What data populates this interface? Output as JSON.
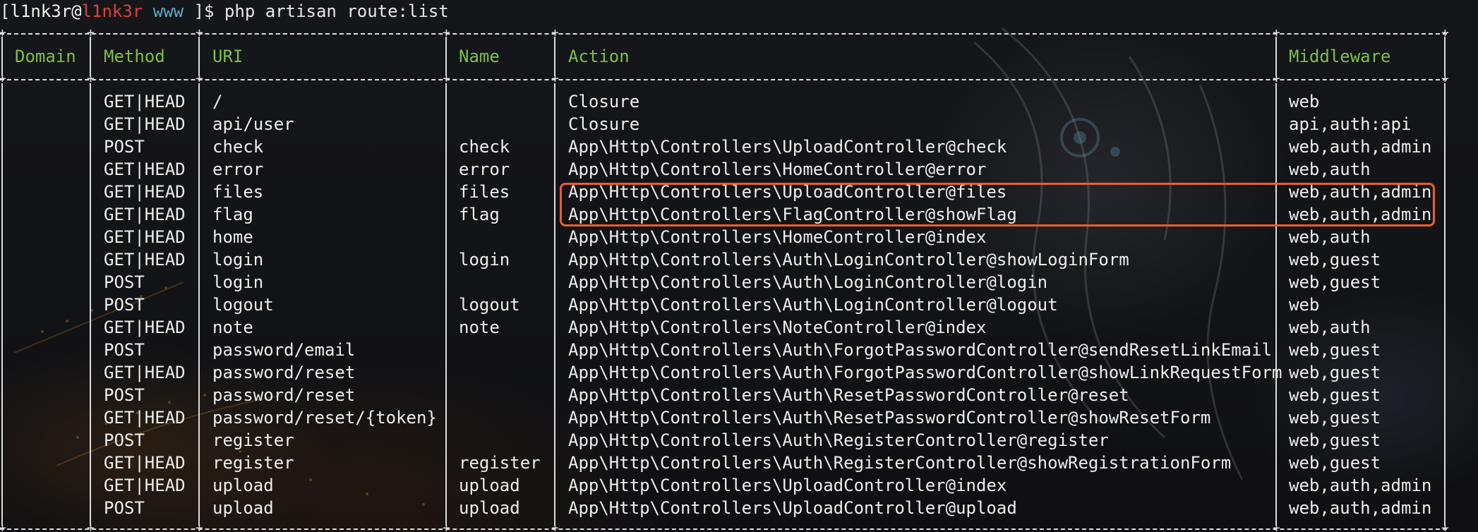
{
  "prompt": {
    "open_bracket": "[",
    "user": "l1nk3r",
    "at": "@",
    "host": "l1nk3r",
    "dir": "www",
    "suffix": " ]$ ",
    "command": "php artisan route:list"
  },
  "table": {
    "headers": {
      "domain": "Domain",
      "method": "Method",
      "uri": "URI",
      "name": "Name",
      "action": "Action",
      "middleware": "Middleware"
    },
    "rows": [
      {
        "domain": "",
        "method": "GET|HEAD",
        "uri": "/",
        "name": "",
        "action": "Closure",
        "middleware": "web"
      },
      {
        "domain": "",
        "method": "GET|HEAD",
        "uri": "api/user",
        "name": "",
        "action": "Closure",
        "middleware": "api,auth:api"
      },
      {
        "domain": "",
        "method": "POST",
        "uri": "check",
        "name": "check",
        "action": "App\\Http\\Controllers\\UploadController@check",
        "middleware": "web,auth,admin"
      },
      {
        "domain": "",
        "method": "GET|HEAD",
        "uri": "error",
        "name": "error",
        "action": "App\\Http\\Controllers\\HomeController@error",
        "middleware": "web,auth"
      },
      {
        "domain": "",
        "method": "GET|HEAD",
        "uri": "files",
        "name": "files",
        "action": "App\\Http\\Controllers\\UploadController@files",
        "middleware": "web,auth,admin"
      },
      {
        "domain": "",
        "method": "GET|HEAD",
        "uri": "flag",
        "name": "flag",
        "action": "App\\Http\\Controllers\\FlagController@showFlag",
        "middleware": "web,auth,admin"
      },
      {
        "domain": "",
        "method": "GET|HEAD",
        "uri": "home",
        "name": "",
        "action": "App\\Http\\Controllers\\HomeController@index",
        "middleware": "web,auth"
      },
      {
        "domain": "",
        "method": "GET|HEAD",
        "uri": "login",
        "name": "login",
        "action": "App\\Http\\Controllers\\Auth\\LoginController@showLoginForm",
        "middleware": "web,guest"
      },
      {
        "domain": "",
        "method": "POST",
        "uri": "login",
        "name": "",
        "action": "App\\Http\\Controllers\\Auth\\LoginController@login",
        "middleware": "web,guest"
      },
      {
        "domain": "",
        "method": "POST",
        "uri": "logout",
        "name": "logout",
        "action": "App\\Http\\Controllers\\Auth\\LoginController@logout",
        "middleware": "web"
      },
      {
        "domain": "",
        "method": "GET|HEAD",
        "uri": "note",
        "name": "note",
        "action": "App\\Http\\Controllers\\NoteController@index",
        "middleware": "web,auth"
      },
      {
        "domain": "",
        "method": "POST",
        "uri": "password/email",
        "name": "",
        "action": "App\\Http\\Controllers\\Auth\\ForgotPasswordController@sendResetLinkEmail",
        "middleware": "web,guest"
      },
      {
        "domain": "",
        "method": "GET|HEAD",
        "uri": "password/reset",
        "name": "",
        "action": "App\\Http\\Controllers\\Auth\\ForgotPasswordController@showLinkRequestForm",
        "middleware": "web,guest"
      },
      {
        "domain": "",
        "method": "POST",
        "uri": "password/reset",
        "name": "",
        "action": "App\\Http\\Controllers\\Auth\\ResetPasswordController@reset",
        "middleware": "web,guest"
      },
      {
        "domain": "",
        "method": "GET|HEAD",
        "uri": "password/reset/{token}",
        "name": "",
        "action": "App\\Http\\Controllers\\Auth\\ResetPasswordController@showResetForm",
        "middleware": "web,guest"
      },
      {
        "domain": "",
        "method": "POST",
        "uri": "register",
        "name": "",
        "action": "App\\Http\\Controllers\\Auth\\RegisterController@register",
        "middleware": "web,guest"
      },
      {
        "domain": "",
        "method": "GET|HEAD",
        "uri": "register",
        "name": "register",
        "action": "App\\Http\\Controllers\\Auth\\RegisterController@showRegistrationForm",
        "middleware": "web,guest"
      },
      {
        "domain": "",
        "method": "GET|HEAD",
        "uri": "upload",
        "name": "upload",
        "action": "App\\Http\\Controllers\\UploadController@index",
        "middleware": "web,auth,admin"
      },
      {
        "domain": "",
        "method": "POST",
        "uri": "upload",
        "name": "upload",
        "action": "App\\Http\\Controllers\\UploadController@upload",
        "middleware": "web,auth,admin"
      }
    ]
  },
  "colors": {
    "prompt_host": "#d9433b",
    "prompt_dir": "#57a9c8",
    "header_text": "#7ec043",
    "highlight_box": "#e8602c",
    "table_border": "#dcdcdc"
  }
}
